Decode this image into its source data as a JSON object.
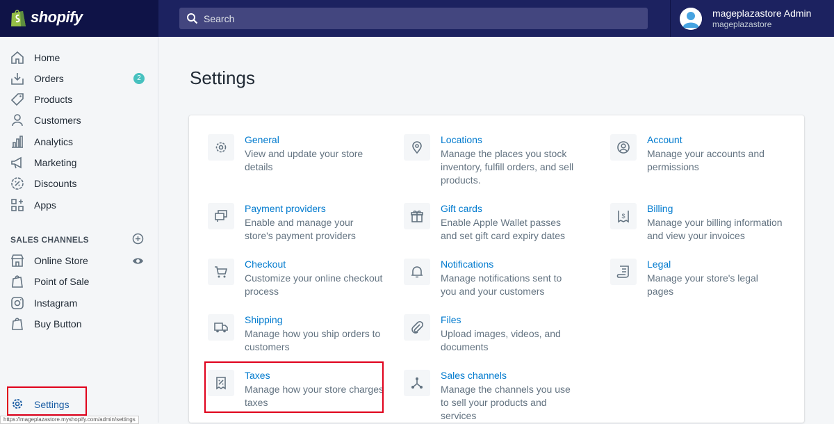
{
  "brand": {
    "logo_text": "shopify"
  },
  "search": {
    "placeholder": "Search"
  },
  "user": {
    "name": "mageplazastore Admin",
    "store": "mageplazastore"
  },
  "sidebar": {
    "items": [
      {
        "label": "Home",
        "icon": "home-icon"
      },
      {
        "label": "Orders",
        "icon": "orders-icon",
        "badge": "2"
      },
      {
        "label": "Products",
        "icon": "products-icon"
      },
      {
        "label": "Customers",
        "icon": "customers-icon"
      },
      {
        "label": "Analytics",
        "icon": "analytics-icon"
      },
      {
        "label": "Marketing",
        "icon": "marketing-icon"
      },
      {
        "label": "Discounts",
        "icon": "discounts-icon"
      },
      {
        "label": "Apps",
        "icon": "apps-icon"
      }
    ],
    "sales_channels_title": "SALES CHANNELS",
    "channels": [
      {
        "label": "Online Store",
        "icon": "online-store-icon"
      },
      {
        "label": "Point of Sale",
        "icon": "point-of-sale-icon"
      },
      {
        "label": "Instagram",
        "icon": "instagram-icon"
      },
      {
        "label": "Buy Button",
        "icon": "buy-button-icon"
      }
    ],
    "settings_label": "Settings"
  },
  "status_url": "https://mageplazastore.myshopify.com/admin/settings",
  "main": {
    "title": "Settings",
    "settings": [
      {
        "title": "General",
        "desc": "View and update your store details",
        "icon": "gear-icon"
      },
      {
        "title": "Locations",
        "desc": "Manage the places you stock inventory, fulfill orders, and sell products.",
        "icon": "location-pin-icon"
      },
      {
        "title": "Account",
        "desc": "Manage your accounts and permissions",
        "icon": "account-icon"
      },
      {
        "title": "Payment providers",
        "desc": "Enable and manage your store's payment providers",
        "icon": "payment-icon"
      },
      {
        "title": "Gift cards",
        "desc": "Enable Apple Wallet passes and set gift card expiry dates",
        "icon": "gift-icon"
      },
      {
        "title": "Billing",
        "desc": "Manage your billing information and view your invoices",
        "icon": "billing-icon"
      },
      {
        "title": "Checkout",
        "desc": "Customize your online checkout process",
        "icon": "cart-icon"
      },
      {
        "title": "Notifications",
        "desc": "Manage notifications sent to you and your customers",
        "icon": "bell-icon"
      },
      {
        "title": "Legal",
        "desc": "Manage your store's legal pages",
        "icon": "legal-icon"
      },
      {
        "title": "Shipping",
        "desc": "Manage how you ship orders to customers",
        "icon": "truck-icon"
      },
      {
        "title": "Files",
        "desc": "Upload images, videos, and documents",
        "icon": "paperclip-icon"
      },
      {
        "title": "Taxes",
        "desc": "Manage how your store charges taxes",
        "icon": "taxes-icon"
      },
      {
        "title": "Sales channels",
        "desc": "Manage the channels you use to sell your products and services",
        "icon": "sales-channels-icon"
      }
    ]
  },
  "colors": {
    "topbar": "#1c2260",
    "link": "#007ace",
    "badge": "#47c1bf",
    "highlight": "#e0001b"
  }
}
